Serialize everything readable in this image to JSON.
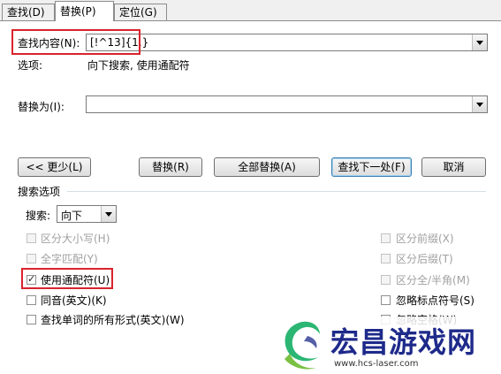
{
  "tabs": [
    {
      "label": "查找(D)"
    },
    {
      "label": "替换(P)"
    },
    {
      "label": "定位(G)"
    }
  ],
  "find": {
    "label": "查找内容(N):",
    "value": "[!^13]{1,}",
    "options_label": "选项:",
    "options_value": "向下搜索, 使用通配符"
  },
  "replace": {
    "label": "替换为(I):",
    "value": ""
  },
  "buttons": {
    "less": "<< 更少(L)",
    "replace": "替换(R)",
    "replace_all": "全部替换(A)",
    "find_next": "查找下一处(F)",
    "cancel": "取消"
  },
  "search_options": {
    "heading": "搜索选项",
    "direction_label": "搜索:",
    "direction_value": "向下"
  },
  "left_options": [
    {
      "label": "区分大小写(H)",
      "checked": false,
      "disabled": true
    },
    {
      "label": "全字匹配(Y)",
      "checked": false,
      "disabled": true
    },
    {
      "label": "使用通配符(U)",
      "checked": true,
      "disabled": false
    },
    {
      "label": "同音(英文)(K)",
      "checked": false,
      "disabled": false
    },
    {
      "label": "查找单词的所有形式(英文)(W)",
      "checked": false,
      "disabled": false
    }
  ],
  "right_options": [
    {
      "label": "区分前缀(X)",
      "checked": false,
      "disabled": true
    },
    {
      "label": "区分后缀(T)",
      "checked": false,
      "disabled": true
    },
    {
      "label": "区分全/半角(M)",
      "checked": false,
      "disabled": true
    },
    {
      "label": "忽略标点符号(S)",
      "checked": false,
      "disabled": false
    },
    {
      "label": "忽略空格(W)",
      "checked": false,
      "disabled": false
    }
  ],
  "watermark": {
    "title": "宏昌游戏网",
    "url": "www.hcs-laser.com"
  },
  "colors": {
    "highlight_box": "#d9232d",
    "watermark_text": "#1e2a8a",
    "logo_green": "#2bb673"
  }
}
